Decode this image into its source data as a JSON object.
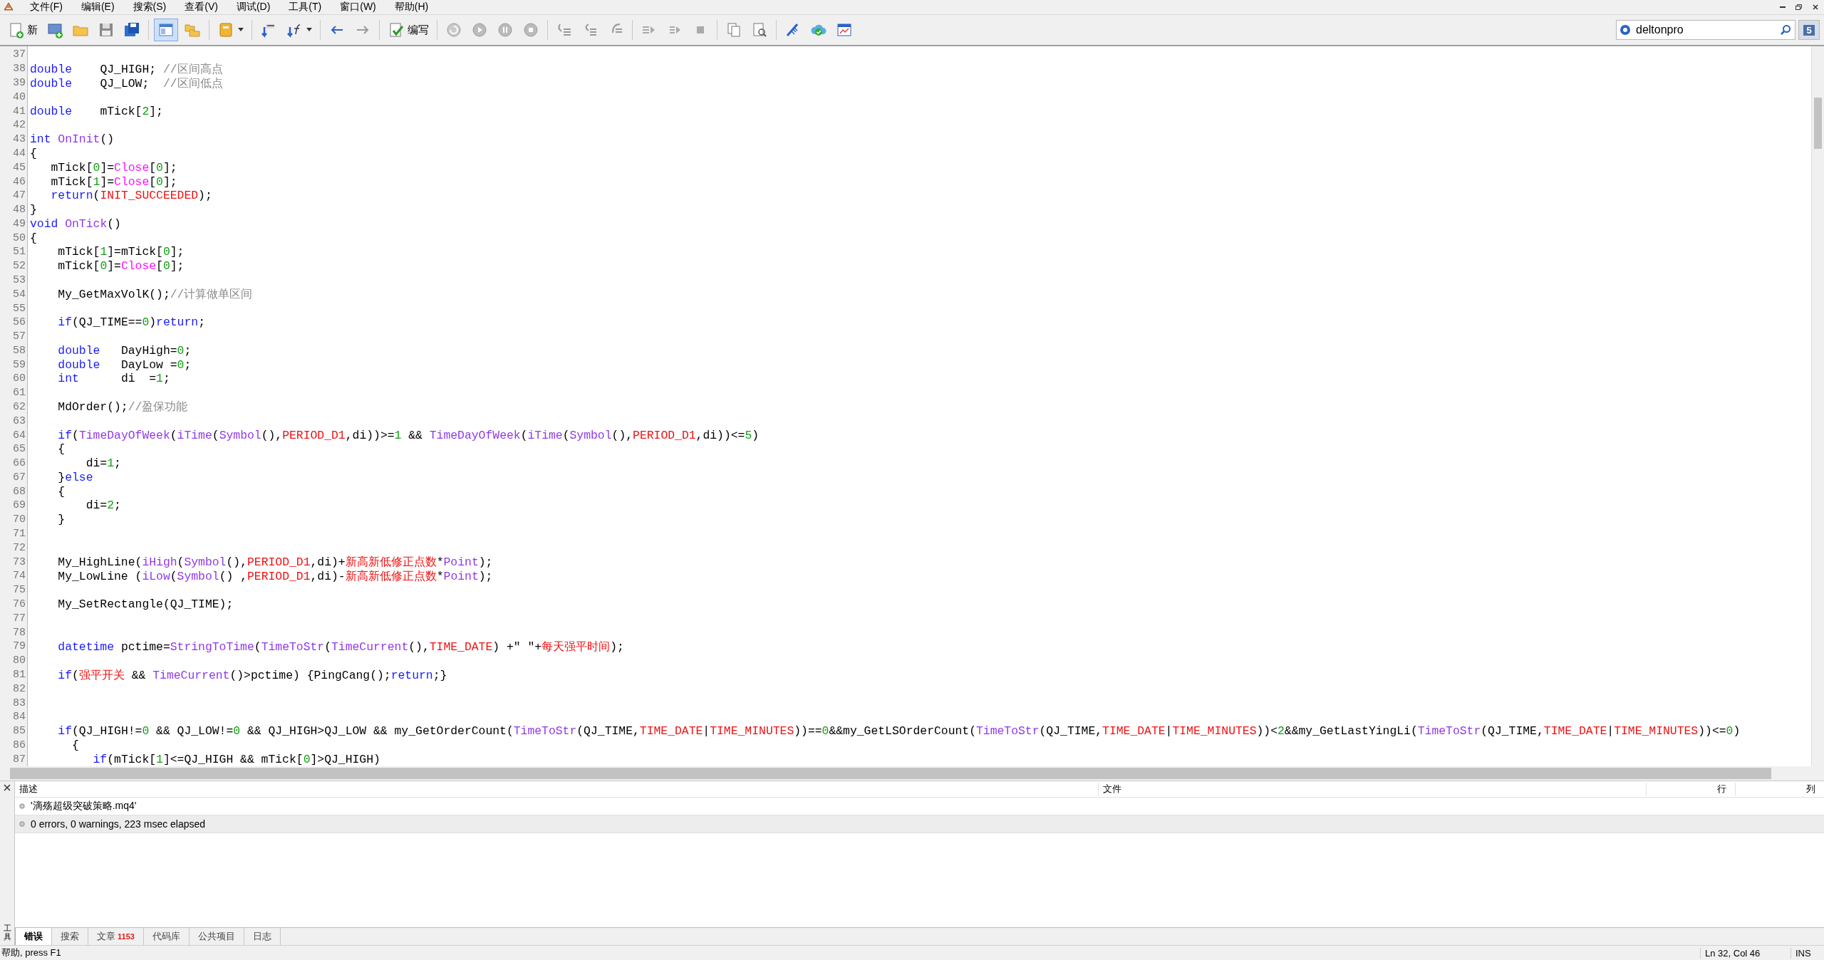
{
  "menu": [
    "文件(F)",
    "编辑(E)",
    "搜索(S)",
    "查看(V)",
    "调试(D)",
    "工具(T)",
    "窗口(W)",
    "帮助(H)"
  ],
  "toolbar": {
    "new_label": "新",
    "compile_label": "编写",
    "search_value": "deltonpro",
    "notification_count": "5"
  },
  "editor": {
    "lines": [
      {
        "num": "37"
      },
      {
        "num": "38",
        "tokens": [
          {
            "kind": "keyword",
            "text": "double"
          },
          {
            "kind": "plain",
            "text": "    QJ_HIGH; "
          },
          {
            "kind": "comment",
            "text": "//区间高点"
          }
        ]
      },
      {
        "num": "39",
        "tokens": [
          {
            "kind": "keyword",
            "text": "double"
          },
          {
            "kind": "plain",
            "text": "    QJ_LOW;  "
          },
          {
            "kind": "comment",
            "text": "//区间低点"
          }
        ]
      },
      {
        "num": "40"
      },
      {
        "num": "41",
        "tokens": [
          {
            "kind": "keyword",
            "text": "double"
          },
          {
            "kind": "plain",
            "text": "    mTick["
          },
          {
            "kind": "number",
            "text": "2"
          },
          {
            "kind": "plain",
            "text": "];"
          }
        ]
      },
      {
        "num": "42"
      },
      {
        "num": "43",
        "tokens": [
          {
            "kind": "keyword",
            "text": "int"
          },
          {
            "kind": "function",
            "text": " OnInit"
          },
          {
            "kind": "plain",
            "text": "()"
          }
        ]
      },
      {
        "num": "44",
        "tokens": [
          {
            "kind": "plain",
            "text": "{"
          }
        ]
      },
      {
        "num": "45",
        "tokens": [
          {
            "kind": "plain",
            "text": "   mTick["
          },
          {
            "kind": "number",
            "text": "0"
          },
          {
            "kind": "plain",
            "text": "]="
          },
          {
            "kind": "builtin",
            "text": "Close"
          },
          {
            "kind": "plain",
            "text": "["
          },
          {
            "kind": "number",
            "text": "0"
          },
          {
            "kind": "plain",
            "text": "];"
          }
        ]
      },
      {
        "num": "46",
        "tokens": [
          {
            "kind": "plain",
            "text": "   mTick["
          },
          {
            "kind": "number",
            "text": "1"
          },
          {
            "kind": "plain",
            "text": "]="
          },
          {
            "kind": "builtin",
            "text": "Close"
          },
          {
            "kind": "plain",
            "text": "["
          },
          {
            "kind": "number",
            "text": "0"
          },
          {
            "kind": "plain",
            "text": "];"
          }
        ]
      },
      {
        "num": "47",
        "tokens": [
          {
            "kind": "keyword",
            "text": "   return"
          },
          {
            "kind": "plain",
            "text": "("
          },
          {
            "kind": "constant",
            "text": "INIT_SUCCEEDED"
          },
          {
            "kind": "plain",
            "text": ");"
          }
        ]
      },
      {
        "num": "48",
        "tokens": [
          {
            "kind": "plain",
            "text": "}"
          }
        ]
      },
      {
        "num": "49",
        "tokens": [
          {
            "kind": "keyword",
            "text": "void"
          },
          {
            "kind": "function",
            "text": " OnTick"
          },
          {
            "kind": "plain",
            "text": "()"
          }
        ]
      },
      {
        "num": "50",
        "tokens": [
          {
            "kind": "plain",
            "text": "{"
          }
        ]
      },
      {
        "num": "51",
        "tokens": [
          {
            "kind": "plain",
            "text": "    mTick["
          },
          {
            "kind": "number",
            "text": "1"
          },
          {
            "kind": "plain",
            "text": "]=mTick["
          },
          {
            "kind": "number",
            "text": "0"
          },
          {
            "kind": "plain",
            "text": "];"
          }
        ]
      },
      {
        "num": "52",
        "tokens": [
          {
            "kind": "plain",
            "text": "    mTick["
          },
          {
            "kind": "number",
            "text": "0"
          },
          {
            "kind": "plain",
            "text": "]="
          },
          {
            "kind": "builtin",
            "text": "Close"
          },
          {
            "kind": "plain",
            "text": "["
          },
          {
            "kind": "number",
            "text": "0"
          },
          {
            "kind": "plain",
            "text": "];"
          }
        ]
      },
      {
        "num": "53"
      },
      {
        "num": "54",
        "tokens": [
          {
            "kind": "plain",
            "text": "    My_GetMaxVolK();"
          },
          {
            "kind": "comment",
            "text": "//计算做单区间"
          }
        ]
      },
      {
        "num": "55"
      },
      {
        "num": "56",
        "tokens": [
          {
            "kind": "keyword",
            "text": "    if"
          },
          {
            "kind": "plain",
            "text": "(QJ_TIME=="
          },
          {
            "kind": "number",
            "text": "0"
          },
          {
            "kind": "plain",
            "text": ")"
          },
          {
            "kind": "keyword",
            "text": "return"
          },
          {
            "kind": "plain",
            "text": ";"
          }
        ]
      },
      {
        "num": "57"
      },
      {
        "num": "58",
        "tokens": [
          {
            "kind": "keyword",
            "text": "    double"
          },
          {
            "kind": "plain",
            "text": "   DayHigh="
          },
          {
            "kind": "number",
            "text": "0"
          },
          {
            "kind": "plain",
            "text": ";"
          }
        ]
      },
      {
        "num": "59",
        "tokens": [
          {
            "kind": "keyword",
            "text": "    double"
          },
          {
            "kind": "plain",
            "text": "   DayLow ="
          },
          {
            "kind": "number",
            "text": "0"
          },
          {
            "kind": "plain",
            "text": ";"
          }
        ]
      },
      {
        "num": "60",
        "tokens": [
          {
            "kind": "keyword",
            "text": "    int"
          },
          {
            "kind": "plain",
            "text": "      di  ="
          },
          {
            "kind": "number",
            "text": "1"
          },
          {
            "kind": "plain",
            "text": ";"
          }
        ]
      },
      {
        "num": "61"
      },
      {
        "num": "62",
        "tokens": [
          {
            "kind": "plain",
            "text": "    MdOrder();"
          },
          {
            "kind": "comment",
            "text": "//盈保功能"
          }
        ]
      },
      {
        "num": "63"
      },
      {
        "num": "64",
        "tokens": [
          {
            "kind": "keyword",
            "text": "    if"
          },
          {
            "kind": "plain",
            "text": "("
          },
          {
            "kind": "function",
            "text": "TimeDayOfWeek"
          },
          {
            "kind": "plain",
            "text": "("
          },
          {
            "kind": "function",
            "text": "iTime"
          },
          {
            "kind": "plain",
            "text": "("
          },
          {
            "kind": "function",
            "text": "Symbol"
          },
          {
            "kind": "plain",
            "text": "(),"
          },
          {
            "kind": "constant",
            "text": "PERIOD_D1"
          },
          {
            "kind": "plain",
            "text": ",di))>="
          },
          {
            "kind": "number",
            "text": "1"
          },
          {
            "kind": "plain",
            "text": " && "
          },
          {
            "kind": "function",
            "text": "TimeDayOfWeek"
          },
          {
            "kind": "plain",
            "text": "("
          },
          {
            "kind": "function",
            "text": "iTime"
          },
          {
            "kind": "plain",
            "text": "("
          },
          {
            "kind": "function",
            "text": "Symbol"
          },
          {
            "kind": "plain",
            "text": "(),"
          },
          {
            "kind": "constant",
            "text": "PERIOD_D1"
          },
          {
            "kind": "plain",
            "text": ",di))<="
          },
          {
            "kind": "number",
            "text": "5"
          },
          {
            "kind": "plain",
            "text": ")"
          }
        ]
      },
      {
        "num": "65",
        "tokens": [
          {
            "kind": "plain",
            "text": "    {"
          }
        ]
      },
      {
        "num": "66",
        "tokens": [
          {
            "kind": "plain",
            "text": "        di="
          },
          {
            "kind": "number",
            "text": "1"
          },
          {
            "kind": "plain",
            "text": ";"
          }
        ]
      },
      {
        "num": "67",
        "tokens": [
          {
            "kind": "plain",
            "text": "    }"
          },
          {
            "kind": "keyword",
            "text": "else"
          }
        ]
      },
      {
        "num": "68",
        "tokens": [
          {
            "kind": "plain",
            "text": "    {"
          }
        ]
      },
      {
        "num": "69",
        "tokens": [
          {
            "kind": "plain",
            "text": "        di="
          },
          {
            "kind": "number",
            "text": "2"
          },
          {
            "kind": "plain",
            "text": ";"
          }
        ]
      },
      {
        "num": "70",
        "tokens": [
          {
            "kind": "plain",
            "text": "    }"
          }
        ]
      },
      {
        "num": "71"
      },
      {
        "num": "72"
      },
      {
        "num": "73",
        "tokens": [
          {
            "kind": "plain",
            "text": "    My_HighLine("
          },
          {
            "kind": "function",
            "text": "iHigh"
          },
          {
            "kind": "plain",
            "text": "("
          },
          {
            "kind": "function",
            "text": "Symbol"
          },
          {
            "kind": "plain",
            "text": "(),"
          },
          {
            "kind": "constant",
            "text": "PERIOD_D1"
          },
          {
            "kind": "plain",
            "text": ",di)+"
          },
          {
            "kind": "constant",
            "text": "新高新低修正点数"
          },
          {
            "kind": "plain",
            "text": "*"
          },
          {
            "kind": "function",
            "text": "Point"
          },
          {
            "kind": "plain",
            "text": ");"
          }
        ]
      },
      {
        "num": "74",
        "tokens": [
          {
            "kind": "plain",
            "text": "    My_LowLine ("
          },
          {
            "kind": "function",
            "text": "iLow"
          },
          {
            "kind": "plain",
            "text": "("
          },
          {
            "kind": "function",
            "text": "Symbol"
          },
          {
            "kind": "plain",
            "text": "() ,"
          },
          {
            "kind": "constant",
            "text": "PERIOD_D1"
          },
          {
            "kind": "plain",
            "text": ",di)-"
          },
          {
            "kind": "constant",
            "text": "新高新低修正点数"
          },
          {
            "kind": "plain",
            "text": "*"
          },
          {
            "kind": "function",
            "text": "Point"
          },
          {
            "kind": "plain",
            "text": ");"
          }
        ]
      },
      {
        "num": "75"
      },
      {
        "num": "76",
        "tokens": [
          {
            "kind": "plain",
            "text": "    My_SetRectangle(QJ_TIME);"
          }
        ]
      },
      {
        "num": "77"
      },
      {
        "num": "78"
      },
      {
        "num": "79",
        "tokens": [
          {
            "kind": "keyword",
            "text": "    datetime"
          },
          {
            "kind": "plain",
            "text": " pctime="
          },
          {
            "kind": "function",
            "text": "StringToTime"
          },
          {
            "kind": "plain",
            "text": "("
          },
          {
            "kind": "function",
            "text": "TimeToStr"
          },
          {
            "kind": "plain",
            "text": "("
          },
          {
            "kind": "function",
            "text": "TimeCurrent"
          },
          {
            "kind": "plain",
            "text": "(),"
          },
          {
            "kind": "constant",
            "text": "TIME_DATE"
          },
          {
            "kind": "plain",
            "text": ") +\" \"+"
          },
          {
            "kind": "constant",
            "text": "每天强平时间"
          },
          {
            "kind": "plain",
            "text": ");"
          }
        ]
      },
      {
        "num": "80"
      },
      {
        "num": "81",
        "tokens": [
          {
            "kind": "keyword",
            "text": "    if"
          },
          {
            "kind": "plain",
            "text": "("
          },
          {
            "kind": "constant",
            "text": "强平开关"
          },
          {
            "kind": "plain",
            "text": " && "
          },
          {
            "kind": "function",
            "text": "TimeCurrent"
          },
          {
            "kind": "plain",
            "text": "()>pctime) {PingCang();"
          },
          {
            "kind": "keyword",
            "text": "return"
          },
          {
            "kind": "plain",
            "text": ";}"
          }
        ]
      },
      {
        "num": "82"
      },
      {
        "num": "83"
      },
      {
        "num": "84"
      },
      {
        "num": "85",
        "tokens": [
          {
            "kind": "keyword",
            "text": "    if"
          },
          {
            "kind": "plain",
            "text": "(QJ_HIGH!="
          },
          {
            "kind": "number",
            "text": "0"
          },
          {
            "kind": "plain",
            "text": " && QJ_LOW!="
          },
          {
            "kind": "number",
            "text": "0"
          },
          {
            "kind": "plain",
            "text": " && QJ_HIGH>QJ_LOW && my_GetOrderCount("
          },
          {
            "kind": "function",
            "text": "TimeToStr"
          },
          {
            "kind": "plain",
            "text": "(QJ_TIME,"
          },
          {
            "kind": "constant",
            "text": "TIME_DATE"
          },
          {
            "kind": "plain",
            "text": "|"
          },
          {
            "kind": "constant",
            "text": "TIME_MINUTES"
          },
          {
            "kind": "plain",
            "text": "))=="
          },
          {
            "kind": "number",
            "text": "0"
          },
          {
            "kind": "plain",
            "text": "&&my_GetLSOrderCount("
          },
          {
            "kind": "function",
            "text": "TimeToStr"
          },
          {
            "kind": "plain",
            "text": "(QJ_TIME,"
          },
          {
            "kind": "constant",
            "text": "TIME_DATE"
          },
          {
            "kind": "plain",
            "text": "|"
          },
          {
            "kind": "constant",
            "text": "TIME_MINUTES"
          },
          {
            "kind": "plain",
            "text": "))<"
          },
          {
            "kind": "number",
            "text": "2"
          },
          {
            "kind": "plain",
            "text": "&&my_GetLastYingLi("
          },
          {
            "kind": "function",
            "text": "TimeToStr"
          },
          {
            "kind": "plain",
            "text": "(QJ_TIME,"
          },
          {
            "kind": "constant",
            "text": "TIME_DATE"
          },
          {
            "kind": "plain",
            "text": "|"
          },
          {
            "kind": "constant",
            "text": "TIME_MINUTES"
          },
          {
            "kind": "plain",
            "text": "))<="
          },
          {
            "kind": "number",
            "text": "0"
          },
          {
            "kind": "plain",
            "text": ")"
          }
        ]
      },
      {
        "num": "86",
        "tokens": [
          {
            "kind": "plain",
            "text": "      {"
          }
        ]
      },
      {
        "num": "87",
        "tokens": [
          {
            "kind": "keyword",
            "text": "         if"
          },
          {
            "kind": "plain",
            "text": "(mTick["
          },
          {
            "kind": "number",
            "text": "1"
          },
          {
            "kind": "plain",
            "text": "]<=QJ_HIGH && mTick["
          },
          {
            "kind": "number",
            "text": "0"
          },
          {
            "kind": "plain",
            "text": "]>QJ_HIGH)"
          }
        ]
      }
    ]
  },
  "toolbox": {
    "side_label": "工具",
    "columns": [
      "描述",
      "文件",
      "行",
      "列"
    ],
    "rows": [
      {
        "text": "'滴殇超级突破策略.mq4'",
        "selected": false
      },
      {
        "text": "0 errors, 0 warnings, 223 msec elapsed",
        "selected": true
      }
    ],
    "tabs": [
      {
        "label": "错误",
        "selected": true
      },
      {
        "label": "搜索",
        "selected": false
      },
      {
        "label": "文章",
        "badge": "1153",
        "selected": false
      },
      {
        "label": "代码库",
        "selected": false
      },
      {
        "label": "公共项目",
        "selected": false
      },
      {
        "label": "日志",
        "selected": false
      }
    ]
  },
  "status_bar": {
    "help": "帮助, press F1",
    "position": "Ln 32, Col 46",
    "mode": "INS"
  }
}
